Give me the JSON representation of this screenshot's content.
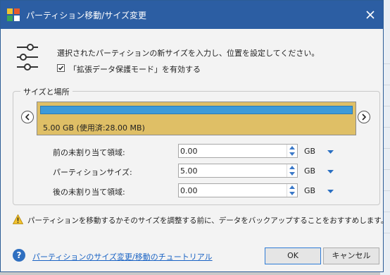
{
  "dialog": {
    "title": "パーティション移動/サイズ変更",
    "description": "選択されたパーティションの新サイズを入力し、位置を設定してください。",
    "checkbox_label": "「拡張データ保護モード」を有効する",
    "checkbox_checked": true
  },
  "group": {
    "title": "サイズと場所",
    "partition_info": "5.00 GB (使用済:28.00 MB)"
  },
  "fields": [
    {
      "label": "前の未割り当て領域:",
      "value": "0.00",
      "unit": "GB"
    },
    {
      "label": "パーティションサイズ:",
      "value": "5.00",
      "unit": "GB"
    },
    {
      "label": "後の未割り当て領域:",
      "value": "0.00",
      "unit": "GB"
    }
  ],
  "warning": "パーティションを移動するかそのサイズを調整する前に、データをバックアップすることをおすすめします。",
  "footer": {
    "help_link": "パーティションのサイズ変更/移動のチュートリアル",
    "ok_label": "OK",
    "cancel_label": "キャンセル"
  },
  "colors": {
    "titlebar": "#2c5ea3",
    "partition_fill": "#dfbf66",
    "partition_bar": "#3d9ad9",
    "link": "#1a63c4"
  }
}
